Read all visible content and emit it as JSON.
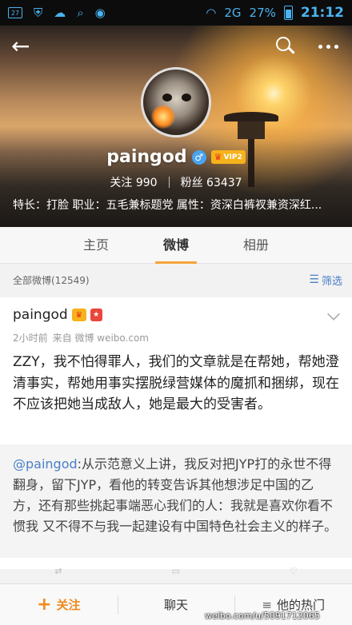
{
  "status_bar": {
    "notification_count": "27",
    "signal_label": "2G",
    "battery": "27%",
    "time": "21:12"
  },
  "profile": {
    "name": "paingod",
    "vip_label": "VIP2",
    "following_label": "关注",
    "following_count": "990",
    "followers_label": "粉丝",
    "followers_count": "63437",
    "bio": "特长：打脸 职业：五毛兼标题党 属性：资深白裤衩兼资深红..."
  },
  "tabs": [
    {
      "label": "主页"
    },
    {
      "label": "微博"
    },
    {
      "label": "相册"
    }
  ],
  "filter_bar": {
    "all_posts": "全部微博(12549)",
    "filter_label": "筛选"
  },
  "post": {
    "author": "paingod",
    "time": "2小时前",
    "source": "来自 微博 weibo.com",
    "text": "ZZY，我不怕得罪人，我们的文章就是在帮她，帮她澄清事实，帮她用事实摆脱绿营媒体的魔抓和捆绑，现在不应该把她当成敌人，她是最大的受害者。",
    "repost_mention": "@paingod",
    "repost_text": ":从示范意义上讲，我反对把JYP打的永世不得翻身，留下JYP，看他的转变告诉其他想涉足中国的乙方，还有那些挑起事端恶心我们的人：我就是喜欢你看不惯我 又不得不与我一起建设有中国特色社会主义的样子。"
  },
  "bottom_bar": {
    "follow": "关注",
    "chat": "聊天",
    "hot": "他的热门"
  },
  "watermark": "weibo.com/u/5091712065",
  "colors": {
    "accent": "#f5a33a",
    "link": "#4a7fc7",
    "status_icons": "#4ab3f0"
  }
}
